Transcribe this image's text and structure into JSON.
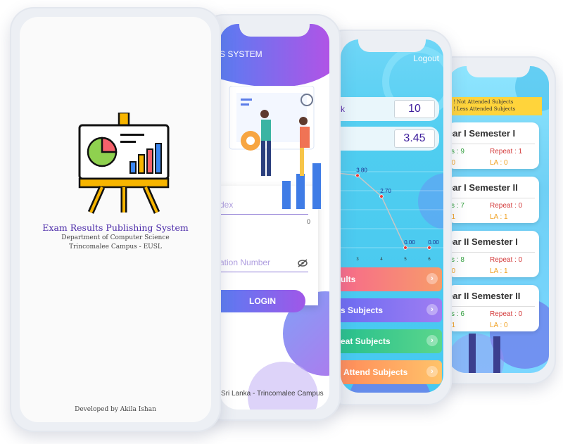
{
  "splash": {
    "title": "Exam Results Publishing System",
    "department": "Department of Computer Science",
    "campus": "Trincomalee Campus - EUSL",
    "footer": "Developed by Akila Ishan"
  },
  "login": {
    "header_title": "S SYSTEM",
    "index_placeholder": "dex",
    "index_counter": "0",
    "reg_placeholder": "ation Number",
    "login_button": "LOGIN",
    "footer": "Sri Lanka - Trincomalee Campus"
  },
  "dashboard": {
    "logout": "Logout",
    "rank_label": "k",
    "rank_value": "10",
    "gpa_value": "3.45",
    "menu": [
      {
        "label": "ults",
        "color": "#f0787f"
      },
      {
        "label": "s Subjects",
        "color": "#7f73ee"
      },
      {
        "label": "eat Subjects",
        "color": "#39c99a"
      },
      {
        "label": "Attend Subjects",
        "color": "#ffad54"
      }
    ]
  },
  "chart_data": {
    "type": "line",
    "x": [
      3,
      4,
      5,
      6
    ],
    "x_tick_labels": [
      "3",
      "4",
      "5",
      "6"
    ],
    "values": [
      3.8,
      2.7,
      0.0,
      0.0
    ],
    "data_labels": [
      "3.80",
      "2.70",
      "0.00",
      "0.00"
    ],
    "ylim": [
      0,
      4
    ],
    "grid": true,
    "title": "",
    "xlabel": "",
    "ylabel": "",
    "line_color": "#c7c7c7",
    "point_color": "#e53935"
  },
  "semesters": {
    "legend": [
      "Not Attended Subjects",
      "Less Attended Subjects"
    ],
    "cards": [
      {
        "title": "ear I Semester I",
        "pass": "ss : 9",
        "repeat": "Repeat : 1",
        "na": ": 0",
        "la": "LA : 0"
      },
      {
        "title": "ear I Semester II",
        "pass": "ss : 7",
        "repeat": "Repeat : 0",
        "na": ": 1",
        "la": "LA : 1"
      },
      {
        "title": "ear II Semester I",
        "pass": "ss : 8",
        "repeat": "Repeat : 0",
        "na": ": 0",
        "la": "LA : 1"
      },
      {
        "title": "ear II Semester II",
        "pass": "ss : 6",
        "repeat": "Repeat : 0",
        "na": ": 1",
        "la": "LA : 0"
      }
    ]
  },
  "colors": {
    "title_purple": "#4a2aa8",
    "pass_green": "#2e9e3a",
    "repeat_red": "#d33a3a",
    "na_orange": "#f0a020",
    "accent_gradient_start": "#5a7cf2",
    "accent_gradient_end": "#b054e6"
  }
}
